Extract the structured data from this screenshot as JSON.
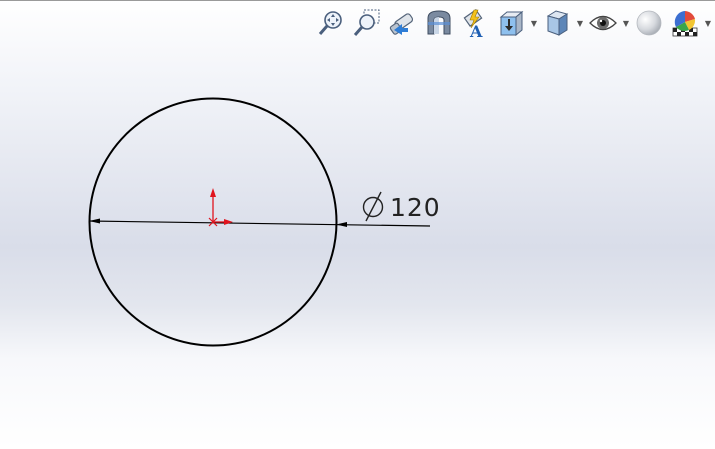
{
  "toolbar": {
    "buttons": [
      {
        "id": "zoom-to-fit",
        "icon": "zoom-to-fit-icon"
      },
      {
        "id": "zoom-to-area",
        "icon": "zoom-to-area-icon"
      },
      {
        "id": "previous-view",
        "icon": "previous-view-icon"
      },
      {
        "id": "section-view",
        "icon": "section-view-icon"
      },
      {
        "id": "dynamic-annotation",
        "icon": "dynamic-annotation-icon"
      },
      {
        "id": "view-orientation",
        "icon": "view-orientation-icon",
        "dropdown": true
      },
      {
        "id": "display-style",
        "icon": "display-style-icon",
        "dropdown": true
      },
      {
        "id": "hide-show-items",
        "icon": "eye-icon",
        "dropdown": true
      },
      {
        "id": "edit-appearance",
        "icon": "appearance-sphere-icon"
      },
      {
        "id": "apply-scene",
        "icon": "scene-icon",
        "dropdown": true
      }
    ]
  },
  "sketch": {
    "dimension_text": "120",
    "dimension_symbol": "⌀",
    "line_color": "#000000",
    "origin_color": "#e0141e"
  }
}
